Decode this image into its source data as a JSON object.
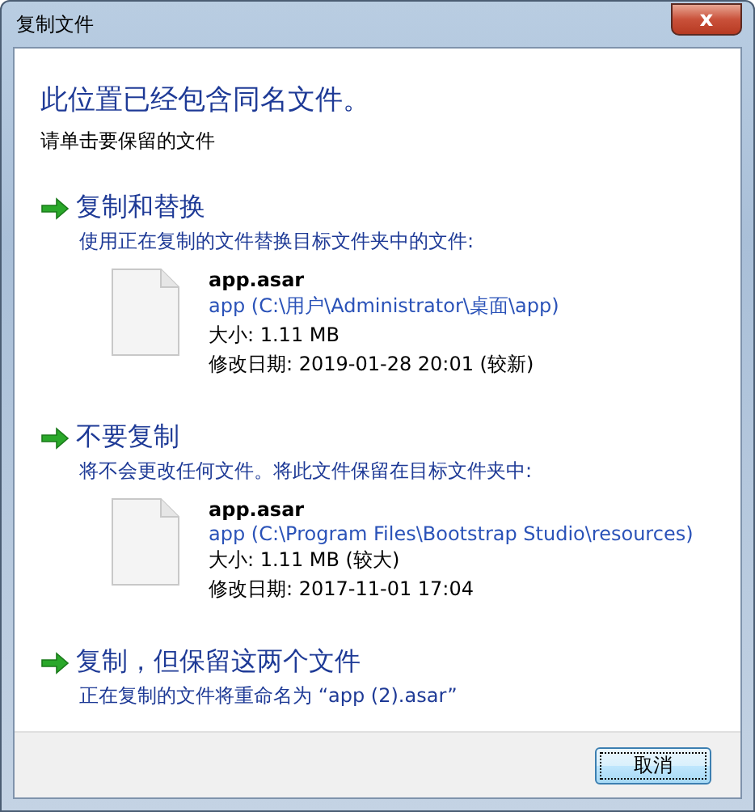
{
  "window": {
    "title": "复制文件",
    "close": "x"
  },
  "heading": "此位置已经包含同名文件。",
  "instruction": "请单击要保留的文件",
  "options": [
    {
      "kind": "file",
      "title": "复制和替换",
      "description": "使用正在复制的文件替换目标文件夹中的文件:",
      "file": {
        "name": "app.asar",
        "location": "app (C:\\用户\\Administrator\\桌面\\app)",
        "size": "大小: 1.11 MB",
        "modified": "修改日期: 2019-01-28 20:01 (较新)"
      }
    },
    {
      "kind": "file",
      "title": "不要复制",
      "description": "将不会更改任何文件。将此文件保留在目标文件夹中:",
      "file": {
        "name": "app.asar",
        "location": "app (C:\\Program Files\\Bootstrap Studio\\resources)",
        "size": "大小: 1.11 MB (较大)",
        "modified": "修改日期: 2017-11-01 17:04"
      }
    },
    {
      "kind": "plain",
      "title": "复制，但保留这两个文件",
      "description": "正在复制的文件将重命名为 “app (2).asar”"
    }
  ],
  "buttons": [
    {
      "label": "取消"
    }
  ]
}
